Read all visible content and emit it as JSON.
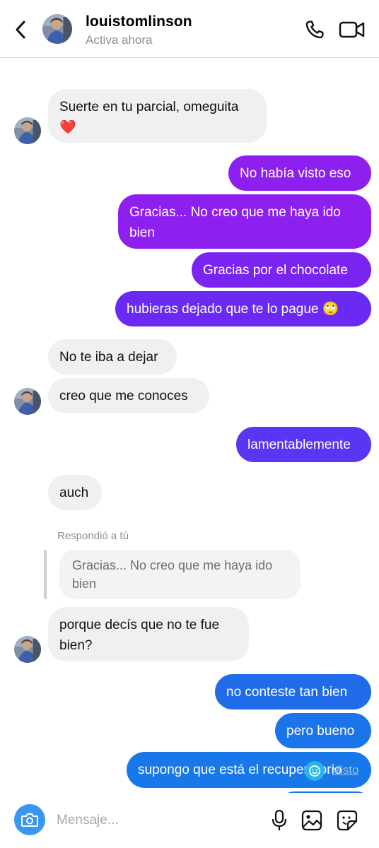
{
  "header": {
    "username": "louistomlinson",
    "status": "Activa ahora",
    "icons": {
      "back": "chevron-left-icon",
      "call": "phone-icon",
      "video": "video-camera-icon"
    }
  },
  "messages": [
    {
      "from": "them",
      "text": "Suerte en tu parcial, omeguita ❤️"
    },
    {
      "from": "me",
      "text": "No había visto eso"
    },
    {
      "from": "me",
      "text": "Gracias... No creo que me haya ido bien"
    },
    {
      "from": "me",
      "text": "Gracias por el chocolate"
    },
    {
      "from": "me",
      "text": "hubieras dejado que te lo pague 🙄"
    },
    {
      "from": "them",
      "text": "No te iba a dejar"
    },
    {
      "from": "them",
      "text": "creo que me conoces"
    },
    {
      "from": "me",
      "text": "lamentablemente"
    },
    {
      "from": "them",
      "text": "auch"
    },
    {
      "from": "them",
      "text": "porque decís que no te fue bien?"
    },
    {
      "from": "me",
      "text": "no conteste tan bien"
    },
    {
      "from": "me",
      "text": "pero bueno"
    },
    {
      "from": "me",
      "text": "supongo que está el recuperatorio"
    }
  ],
  "reply": {
    "label": "Respondió a tú",
    "quoted_text": "Gracias... No creo que me haya ido bien"
  },
  "seen_label": "Visto",
  "composer": {
    "placeholder": "Mensaje...",
    "icons": {
      "camera": "camera-icon",
      "mic": "microphone-icon",
      "gallery": "image-icon",
      "sticker": "sticker-icon"
    }
  },
  "colors": {
    "received_bubble": "#f0f0f2",
    "sent_gradient_top": "#8d1fef",
    "sent_gradient_bottom": "#1878ea",
    "camera_button": "#3897f0"
  }
}
